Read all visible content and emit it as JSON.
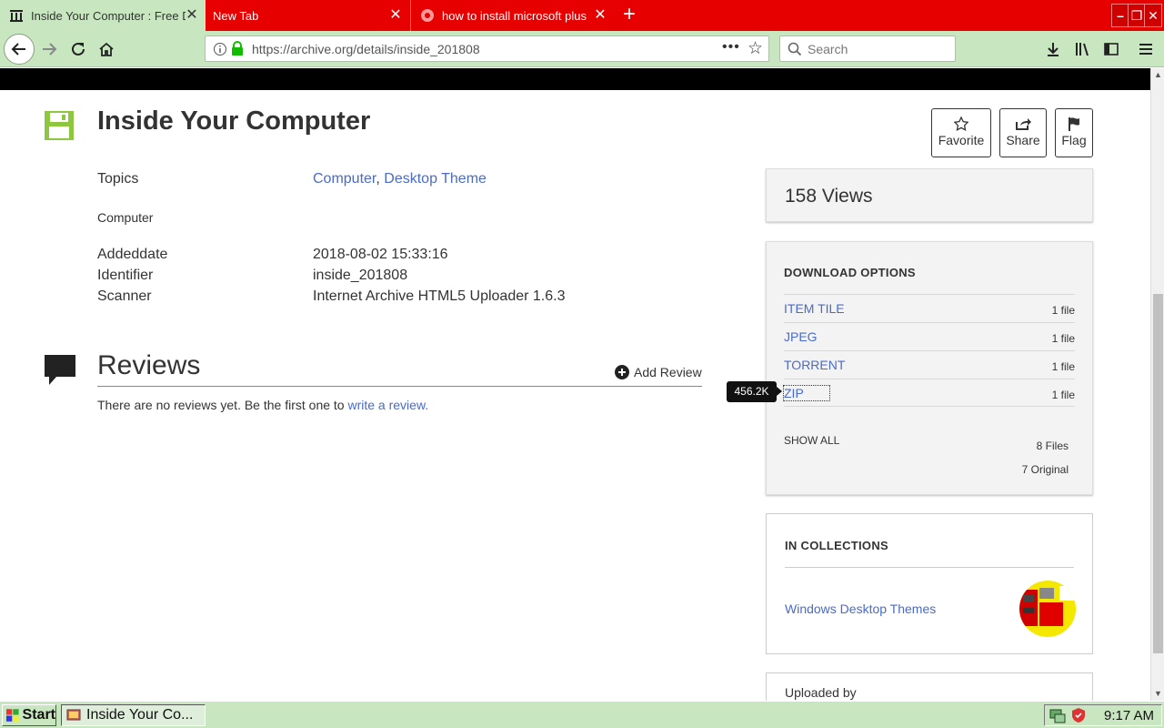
{
  "browser": {
    "tabs": [
      {
        "title": "Inside Your Computer : Free D",
        "active": true
      },
      {
        "title": "New Tab",
        "active": false
      },
      {
        "title": "how to install microsoft plus th",
        "active": false
      }
    ],
    "url": "https://archive.org/details/inside_201808",
    "search_placeholder": "Search"
  },
  "item": {
    "title": "Inside Your Computer",
    "actions": {
      "favorite": "Favorite",
      "share": "Share",
      "flag": "Flag"
    },
    "metadata": {
      "topics_label": "Topics",
      "topic_1": "Computer",
      "topic_separator": ",",
      "topic_2": "Desktop Theme",
      "description": "Computer",
      "addeddate_label": "Addeddate",
      "addeddate": "2018-08-02 15:33:16",
      "identifier_label": "Identifier",
      "identifier": "inside_201808",
      "scanner_label": "Scanner",
      "scanner": "Internet Archive HTML5 Uploader 1.6.3"
    }
  },
  "reviews": {
    "title": "Reviews",
    "add_label": "Add Review",
    "empty_text": "There are no reviews yet. Be the first one to ",
    "empty_link": "write a review."
  },
  "sidebar": {
    "views": "158 Views",
    "download": {
      "heading": "DOWNLOAD OPTIONS",
      "options": [
        {
          "name": "ITEM TILE",
          "count": "1 file"
        },
        {
          "name": "JPEG",
          "count": "1 file"
        },
        {
          "name": "TORRENT",
          "count": "1 file"
        },
        {
          "name": "ZIP",
          "count": "1 file"
        }
      ],
      "show_all": "SHOW ALL",
      "total_files": "8 Files",
      "original_files": "7 Original",
      "tooltip": "456.2K"
    },
    "collections": {
      "heading": "IN COLLECTIONS",
      "item": "Windows Desktop Themes"
    },
    "uploaded_by": "Uploaded by"
  },
  "taskbar": {
    "start": "Start",
    "window": "Inside Your Co...",
    "clock": "9:17 AM"
  },
  "colors": {
    "accent_link": "#4a6bc8",
    "tab_bar": "#e60000",
    "chrome": "#c8e6c0",
    "item_icon": "#8dc63f"
  }
}
